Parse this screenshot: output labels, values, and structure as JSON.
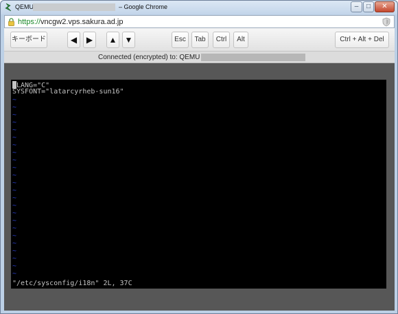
{
  "window": {
    "app_name": "QEMU",
    "title_suffix": "– Google Chrome",
    "minimize_glyph": "‒",
    "maximize_glyph": "□",
    "close_glyph": "✕"
  },
  "address_bar": {
    "scheme": "https://",
    "host": "vncgw2.vps.sakura.ad.jp"
  },
  "toolbar": {
    "keyboard_label": "キーボード",
    "left_arrow": "◀",
    "right_arrow": "▶",
    "up_arrow": "▲",
    "down_arrow": "▼",
    "esc_label": "Esc",
    "tab_label": "Tab",
    "ctrl_label": "Ctrl",
    "alt_label": "Alt",
    "ctrl_alt_del_label": "Ctrl + Alt + Del"
  },
  "status": {
    "connection_text": "Connected (encrypted) to: QEMU"
  },
  "terminal": {
    "line1": "LANG=\"C\"",
    "line2": "SYSFONT=\"latarcyrheb-sun16\"",
    "tilde_char": "~",
    "status_line": "\"/etc/sysconfig/i18n\" 2L, 37C"
  },
  "colors": {
    "terminal_bg": "#000000",
    "terminal_text": "#c4c4c4",
    "tilde": "#2b3fd0",
    "https_green": "#1b8a2a"
  },
  "icons": [
    "app-icon",
    "lock-icon",
    "shield-icon"
  ]
}
